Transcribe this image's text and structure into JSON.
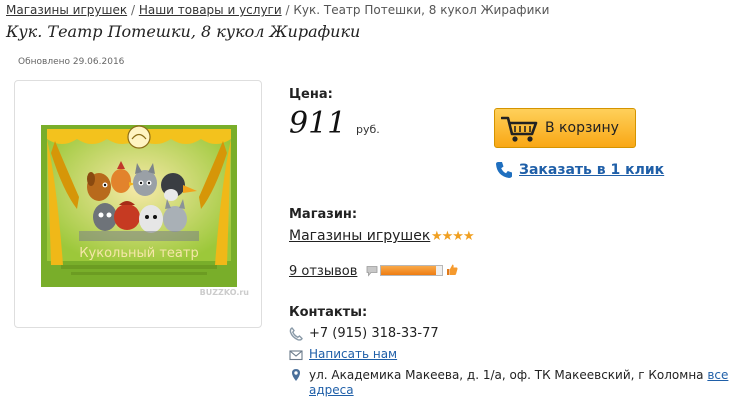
{
  "breadcrumb": {
    "items": [
      "Магазины игрушек",
      "Наши товары и услуги",
      "Кук. Театр Потешки, 8 кукол Жирафики"
    ],
    "separator": "/"
  },
  "product": {
    "title": "Кук. Театр Потешки, 8 кукол Жирафики",
    "updated": "Обновлено 29.06.2016",
    "image_caption": "Кукольный театр",
    "watermark": "BUZZKO.ru",
    "image_icon": "puppet-theater-box-image"
  },
  "price": {
    "label": "Цена:",
    "value": "911",
    "currency": "руб."
  },
  "cart": {
    "button_label": "В корзину",
    "one_click_label": "Заказать в 1 клик",
    "icon": "shopping-cart-icon",
    "button_color": "#f9a715"
  },
  "shop": {
    "label": "Магазин:",
    "name": "Магазины игрушек",
    "stars": "★★★★",
    "rating": 4,
    "reviews_label": "9 отзывов",
    "rating_fraction": 0.9,
    "rating_color": "#ee7d12"
  },
  "contacts": {
    "label": "Контакты:",
    "phone": "+7 (915) 318-33-77",
    "write_label": "Написать нам",
    "address": "ул. Академика Макеева, д. 1/а, оф. ТК Макеевский, г Коломна",
    "all_addresses_label": "все адреса"
  }
}
